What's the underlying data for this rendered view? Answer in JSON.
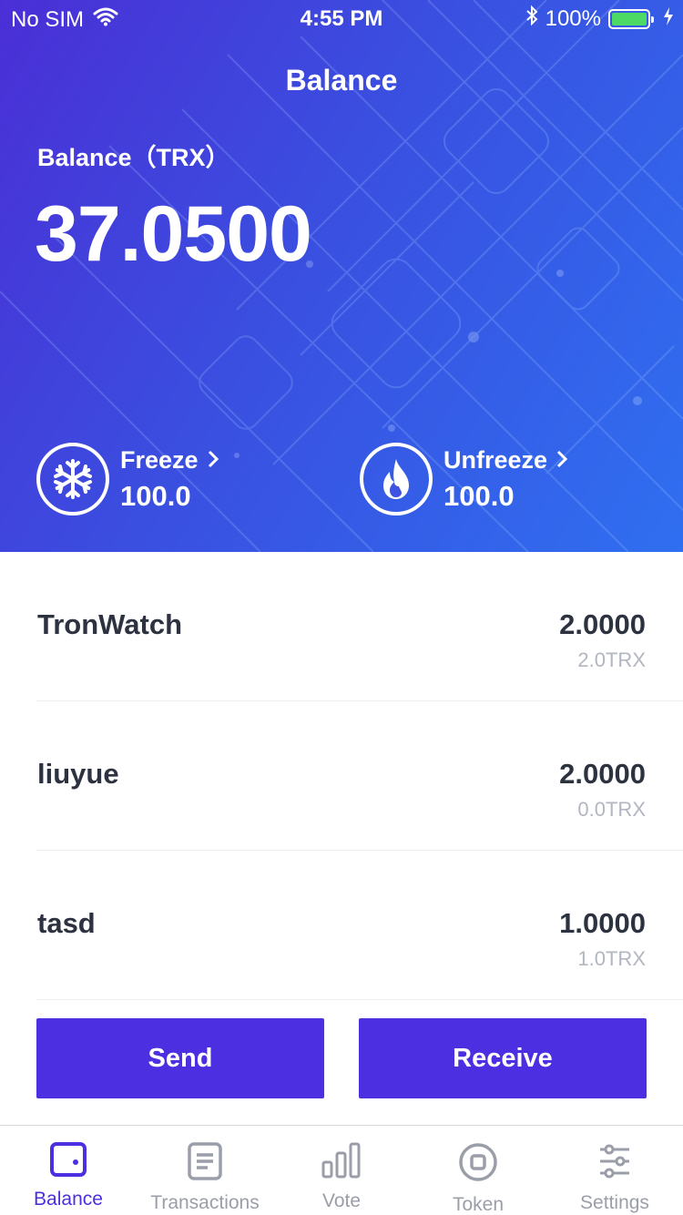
{
  "status_bar": {
    "carrier": "No SIM",
    "time": "4:55 PM",
    "battery_percent": "100%",
    "battery_level": 1.0,
    "icons": [
      "wifi-icon",
      "bluetooth-icon",
      "battery-icon",
      "charging-icon"
    ]
  },
  "header": {
    "title": "Balance",
    "balance_label": "Balance（TRX）",
    "balance_value": "37.0500"
  },
  "stats": {
    "freeze": {
      "label": "Freeze",
      "value": "100.0",
      "icon": "snowflake-icon"
    },
    "unfreeze": {
      "label": "Unfreeze",
      "value": "100.0",
      "icon": "flame-icon"
    }
  },
  "tokens": [
    {
      "name": "TronWatch",
      "amount": "2.0000",
      "trx": "2.0TRX"
    },
    {
      "name": "liuyue",
      "amount": "2.0000",
      "trx": "0.0TRX"
    },
    {
      "name": "tasd",
      "amount": "1.0000",
      "trx": "1.0TRX"
    }
  ],
  "actions": {
    "send_label": "Send",
    "receive_label": "Receive"
  },
  "tabbar": {
    "items": [
      {
        "label": "Balance",
        "icon": "wallet-icon",
        "active": true
      },
      {
        "label": "Transactions",
        "icon": "document-icon",
        "active": false
      },
      {
        "label": "Vote",
        "icon": "bar-chart-icon",
        "active": false
      },
      {
        "label": "Token",
        "icon": "token-icon",
        "active": false
      },
      {
        "label": "Settings",
        "icon": "sliders-icon",
        "active": false
      }
    ]
  },
  "colors": {
    "accent": "#4b2fe0",
    "hero_gradient_start": "#4a2fd6",
    "hero_gradient_end": "#2f6ff0",
    "battery_fill": "#4cd964",
    "inactive_tab": "#9a9ea8",
    "secondary_text": "#b2b6c0"
  }
}
